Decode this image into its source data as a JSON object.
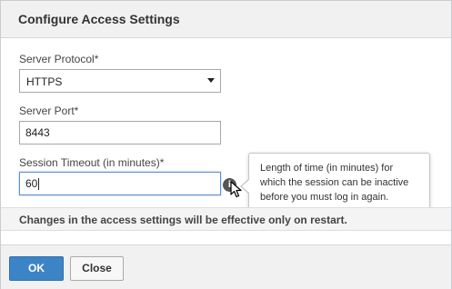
{
  "dialog": {
    "title": "Configure Access Settings"
  },
  "fields": {
    "protocol": {
      "label": "Server Protocol*",
      "value": "HTTPS"
    },
    "port": {
      "label": "Server Port*",
      "value": "8443"
    },
    "timeout": {
      "label": "Session Timeout (in minutes)*",
      "value": "60"
    }
  },
  "tooltip": {
    "line1": "Length of time (in minutes) for",
    "line2": "which the session can be inactive",
    "line3": "before you must log in again."
  },
  "notice": {
    "text": "Changes in the access settings will be effective only on restart."
  },
  "buttons": {
    "ok_label": "OK",
    "close_label": "Close"
  },
  "colors": {
    "primary_button": "#3d84c6",
    "focus_border": "#5b8fd1"
  },
  "icons": {
    "info": "info-icon",
    "cursor": "pointer-cursor-icon"
  }
}
